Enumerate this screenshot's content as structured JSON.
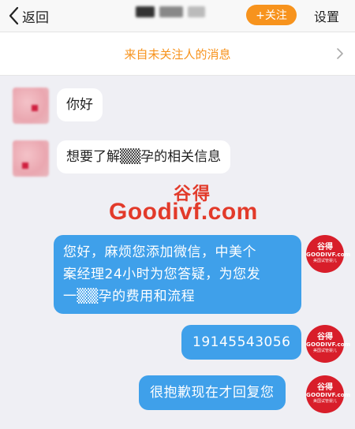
{
  "header": {
    "back_label": "返回",
    "follow_label": "+关注",
    "settings_label": "设置"
  },
  "notice": {
    "label": "来自未关注人的消息"
  },
  "messages": [
    {
      "side": "left",
      "text": "你好"
    },
    {
      "side": "left",
      "text": "想要了解▒▒孕的相关信息"
    },
    {
      "side": "right",
      "lines": [
        "您好，麻烦您添加微信，中美个",
        "案经理24小时为您答疑，为您发",
        "一▒▒孕的费用和流程"
      ]
    },
    {
      "side": "right",
      "text": "19145543056"
    },
    {
      "side": "right",
      "text": "很抱歉现在才回复您"
    }
  ],
  "avatar_brand": {
    "cn": "谷得",
    "en": "GOODIVF.com",
    "sub": "美国试管婴儿"
  },
  "watermark": {
    "cn": "谷得",
    "en": "Goodivf.com"
  },
  "colors": {
    "accent": "#f7931d",
    "bubble_blue": "#3fa0ea",
    "brand_red": "#d81e2a"
  }
}
